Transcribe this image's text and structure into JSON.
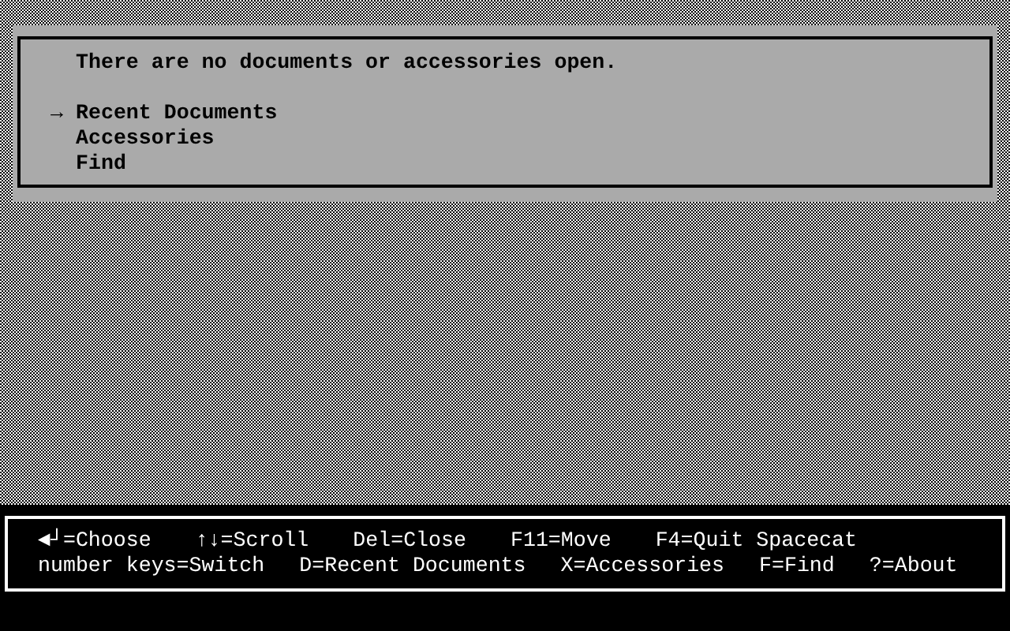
{
  "panel": {
    "message": "There are no documents or accessories open.",
    "selection_marker": "→",
    "menu": [
      {
        "label": "Recent Documents",
        "selected": true
      },
      {
        "label": "Accessories",
        "selected": false
      },
      {
        "label": "Find",
        "selected": false
      }
    ]
  },
  "key_help": [
    [
      "◄┘=Choose",
      "↑↓=Scroll",
      "Del=Close",
      "F11=Move",
      "F4=Quit Spacecat"
    ],
    [
      "number keys=Switch",
      "D=Recent Documents",
      "X=Accessories",
      "F=Find",
      "?=About"
    ]
  ]
}
